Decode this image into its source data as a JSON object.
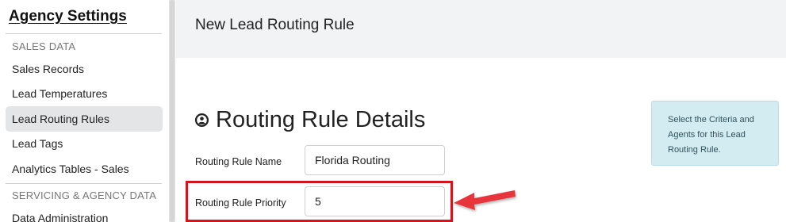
{
  "sidebar": {
    "title": "Agency Settings",
    "sections": [
      {
        "label": "SALES DATA",
        "items": [
          {
            "label": "Sales Records",
            "active": false
          },
          {
            "label": "Lead Temperatures",
            "active": false
          },
          {
            "label": "Lead Routing Rules",
            "active": true
          },
          {
            "label": "Lead Tags",
            "active": false
          },
          {
            "label": "Analytics Tables - Sales",
            "active": false
          }
        ]
      },
      {
        "label": "SERVICING & AGENCY DATA",
        "items": [
          {
            "label": "Data Administration",
            "active": false
          }
        ]
      }
    ]
  },
  "header": {
    "title": "New Lead Routing Rule"
  },
  "details": {
    "heading": "Routing Rule Details",
    "heading_icon": "user-circle-icon",
    "info_text": "Select the Criteria and Agents for this Lead Routing Rule.",
    "fields": [
      {
        "label": "Routing Rule Name",
        "value": "Florida Routing"
      },
      {
        "label": "Routing Rule Priority",
        "value": "5"
      }
    ]
  },
  "annotation": {
    "highlight_color": "#d6141d",
    "arrow_color": "#e8363c",
    "arrow_icon": "arrow-left-icon"
  }
}
